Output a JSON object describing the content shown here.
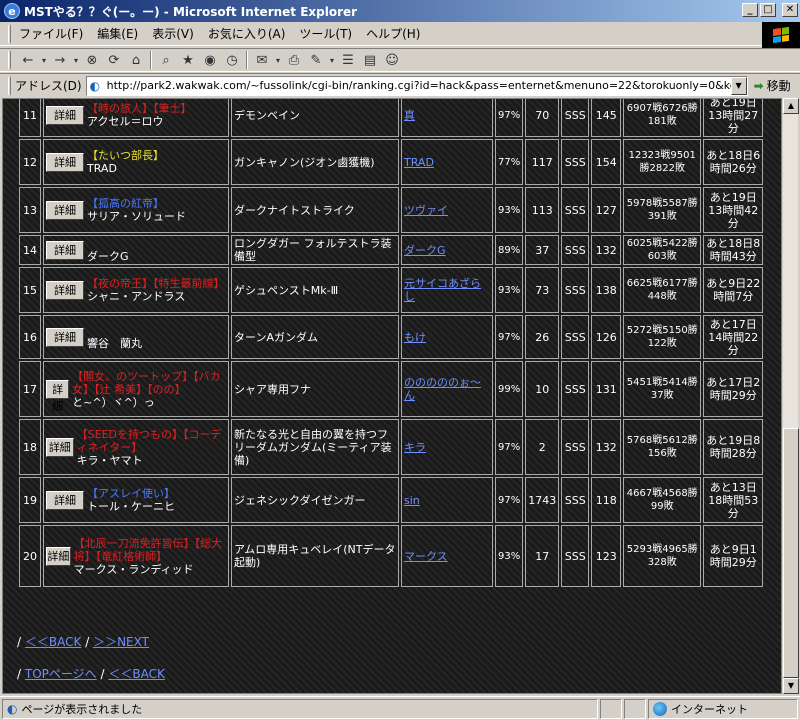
{
  "window": {
    "title": "MSTやる？？ぐ(ー。ー) - Microsoft Internet Explorer",
    "min": "_",
    "max": "□",
    "close": "✕"
  },
  "menu": [
    "ファイル(F)",
    "編集(E)",
    "表示(V)",
    "お気に入り(A)",
    "ツール(T)",
    "ヘルプ(H)"
  ],
  "address": {
    "label": "アドレス(D)",
    "url": "http://park2.wakwak.com/~fussolink/cgi-bin/ranking.cgi?id=hack&pass=enternet&menuno=22&torokuonly=0&kekaonly=0&to",
    "go": "移動"
  },
  "detail_label": "詳細",
  "rows": [
    {
      "rank": "11",
      "title": "【時の旅人】【筆士】",
      "title_color": "red",
      "name": "アクセル＝ロウ",
      "mecha": "デモンベイン",
      "pilot": "真",
      "pct": "97%",
      "n1": "70",
      "grade": "SSS",
      "pts": "145",
      "record": "6907戦6726勝181敗",
      "time": "あと19日13時間27分"
    },
    {
      "rank": "12",
      "title": "【たいつ部長】",
      "title_color": "yellow",
      "name": "TRAD",
      "mecha": "ガンキャノン(ジオン鹵獲機)",
      "pilot": "TRAD",
      "pct": "77%",
      "n1": "117",
      "grade": "SSS",
      "pts": "154",
      "record": "12323戦9501勝2822敗",
      "time": "あと18日6時間26分"
    },
    {
      "rank": "13",
      "title": "【孤高の紅帝】",
      "title_color": "blue",
      "name": "サリア・ソリュード",
      "mecha": "ダークナイトストライク",
      "pilot": "ツヴァイ",
      "pct": "93%",
      "n1": "113",
      "grade": "SSS",
      "pts": "127",
      "record": "5978戦5587勝391敗",
      "time": "あと19日13時間42分"
    },
    {
      "rank": "14",
      "title": "",
      "title_color": "red",
      "name": "ダークG",
      "mecha": "ロングダガー フォルテストラ装備型",
      "pilot": "ダークG",
      "pct": "89%",
      "n1": "37",
      "grade": "SSS",
      "pts": "132",
      "record": "6025戦5422勝603敗",
      "time": "あと18日8時間43分"
    },
    {
      "rank": "15",
      "title": "【夜の帝王】【特生最前線】",
      "title_color": "red",
      "name": "シャニ・アンドラス",
      "mecha": "ゲシュペンストMk-Ⅲ",
      "pilot": "元サイコあざらし",
      "pct": "93%",
      "n1": "73",
      "grade": "SSS",
      "pts": "138",
      "record": "6625戦6177勝448敗",
      "time": "あと9日22時間7分"
    },
    {
      "rank": "16",
      "title": "",
      "title_color": "red",
      "name": "響谷　蘭丸",
      "mecha": "ターンAガンダム",
      "pilot": "もけ",
      "pct": "97%",
      "n1": "26",
      "grade": "SSS",
      "pts": "126",
      "record": "5272戦5150勝122敗",
      "time": "あと17日14時間22分"
    },
    {
      "rank": "17",
      "title": "【閣女。のツートップ】【バカ女】【辻 希美】【のの】",
      "title_color": "red",
      "name": "と~^）ヾ^）っ",
      "mecha": "シャア専用フナ",
      "pilot": "のののののぉ〜ん",
      "pct": "99%",
      "n1": "10",
      "grade": "SSS",
      "pts": "131",
      "record": "5451戦5414勝37敗",
      "time": "あと17日2時間29分"
    },
    {
      "rank": "18",
      "title": "【SEEDを持つもの】【コーディネイター】",
      "title_color": "red",
      "name": "キラ・ヤマト",
      "mecha": "新たなる光と自由の翼を持つフリーダムガンダム(ミーティア装備)",
      "pilot": "キラ",
      "pct": "97%",
      "n1": "2",
      "grade": "SSS",
      "pts": "132",
      "record": "5768戦5612勝156敗",
      "time": "あと19日8時間28分"
    },
    {
      "rank": "19",
      "title": "【アスレイ使い】",
      "title_color": "blue",
      "name": "トール・ケーニヒ",
      "mecha": "ジェネシックダイゼンガー",
      "pilot": "sin",
      "pct": "97%",
      "n1": "1743",
      "grade": "SSS",
      "pts": "118",
      "record": "4667戦4568勝99敗",
      "time": "あと13日18時間53分"
    },
    {
      "rank": "20",
      "title": "【北辰一刀流免許皆伝】【総大将】【竜紅格術師】",
      "title_color": "red",
      "name": "マークス・ランディッド",
      "mecha": "アムロ専用キュベレイ(NTデータ起動)",
      "pilot": "マークス",
      "pct": "93%",
      "n1": "17",
      "grade": "SSS",
      "pts": "123",
      "record": "5293戦4965勝328敗",
      "time": "あと9日1時間29分"
    }
  ],
  "nav": {
    "slash": "/",
    "back": "＜＜BACK",
    "next": "＞＞NEXT",
    "top": "TOPページへ"
  },
  "status": {
    "text": "ページが表示されました",
    "zone": "インターネット"
  }
}
